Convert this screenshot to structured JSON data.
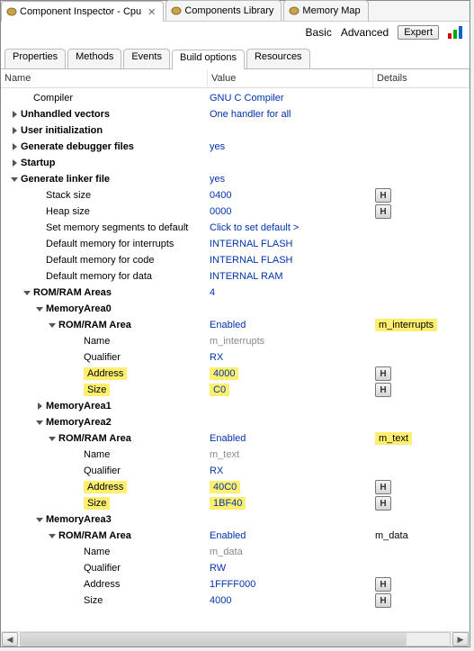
{
  "top_tabs": {
    "inspector": "Component Inspector - Cpu",
    "library": "Components Library",
    "memory": "Memory Map"
  },
  "modes": {
    "basic": "Basic",
    "advanced": "Advanced",
    "expert": "Expert"
  },
  "inner_tabs": {
    "properties": "Properties",
    "methods": "Methods",
    "events": "Events",
    "build": "Build options",
    "resources": "Resources"
  },
  "headers": {
    "name": "Name",
    "value": "Value",
    "details": "Details"
  },
  "badge": "H",
  "rows": {
    "compiler": {
      "name": "Compiler",
      "value": "GNU C Compiler"
    },
    "unhandled": {
      "name": "Unhandled vectors",
      "value": "One handler for all"
    },
    "userinit": {
      "name": "User initialization"
    },
    "gendbg": {
      "name": "Generate debugger files",
      "value": "yes"
    },
    "startup": {
      "name": "Startup"
    },
    "genlink": {
      "name": "Generate linker file",
      "value": "yes"
    },
    "stack": {
      "name": "Stack size",
      "value": "0400"
    },
    "heap": {
      "name": "Heap size",
      "value": "0000"
    },
    "setdef": {
      "name": "Set memory segments to default",
      "value": "Click to set default >"
    },
    "defint": {
      "name": "Default memory for interrupts",
      "value": "INTERNAL FLASH"
    },
    "defcode": {
      "name": "Default memory for code",
      "value": "INTERNAL FLASH"
    },
    "defdata": {
      "name": "Default memory for data",
      "value": "INTERNAL RAM"
    },
    "romram": {
      "name": "ROM/RAM Areas",
      "value": "4"
    },
    "ma0": {
      "name": "MemoryArea0"
    },
    "ma0_area": {
      "name": "ROM/RAM Area",
      "value": "Enabled",
      "details": "m_interrupts"
    },
    "ma0_name": {
      "name": "Name",
      "value": "m_interrupts"
    },
    "ma0_qual": {
      "name": "Qualifier",
      "value": "RX"
    },
    "ma0_addr": {
      "name": "Address",
      "value": "4000"
    },
    "ma0_size": {
      "name": "Size",
      "value": "C0"
    },
    "ma1": {
      "name": "MemoryArea1"
    },
    "ma2": {
      "name": "MemoryArea2"
    },
    "ma2_area": {
      "name": "ROM/RAM Area",
      "value": "Enabled",
      "details": "m_text"
    },
    "ma2_name": {
      "name": "Name",
      "value": "m_text"
    },
    "ma2_qual": {
      "name": "Qualifier",
      "value": "RX"
    },
    "ma2_addr": {
      "name": "Address",
      "value": "40C0"
    },
    "ma2_size": {
      "name": "Size",
      "value": "1BF40"
    },
    "ma3": {
      "name": "MemoryArea3"
    },
    "ma3_area": {
      "name": "ROM/RAM Area",
      "value": "Enabled",
      "details": "m_data"
    },
    "ma3_name": {
      "name": "Name",
      "value": "m_data"
    },
    "ma3_qual": {
      "name": "Qualifier",
      "value": "RW"
    },
    "ma3_addr": {
      "name": "Address",
      "value": "1FFFF000"
    },
    "ma3_size": {
      "name": "Size",
      "value": "4000"
    }
  }
}
